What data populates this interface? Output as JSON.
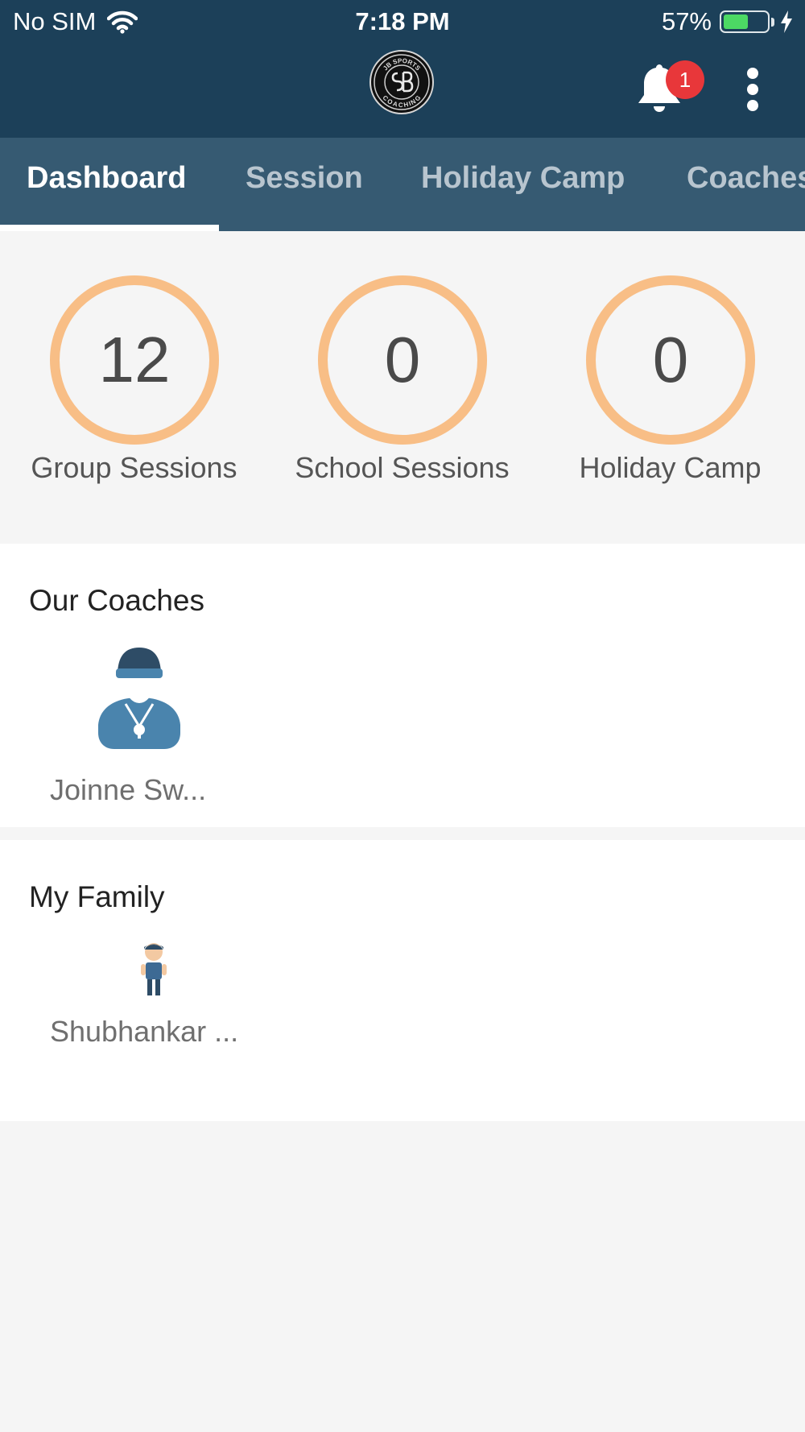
{
  "status_bar": {
    "carrier": "No SIM",
    "time": "7:18 PM",
    "battery_percent_text": "57%",
    "battery_level": 0.57
  },
  "header": {
    "logo_text_top": "JB SPORTS",
    "logo_text_bottom": "COACHING",
    "notification_count": "1",
    "icons": [
      "wifi-icon",
      "battery-icon",
      "charging-icon",
      "bell-icon",
      "more-vertical-icon"
    ]
  },
  "tabs": [
    {
      "label": "Dashboard",
      "active": true
    },
    {
      "label": "Session",
      "active": false
    },
    {
      "label": "Holiday Camp",
      "active": false
    },
    {
      "label": "Coaches",
      "active": false
    }
  ],
  "stats": [
    {
      "value": "12",
      "label": "Group Sessions"
    },
    {
      "value": "0",
      "label": "School Sessions"
    },
    {
      "value": "0",
      "label": "Holiday Camp"
    }
  ],
  "coaches": {
    "title": "Our Coaches",
    "items": [
      {
        "name": "Joinne Sw..."
      }
    ]
  },
  "family": {
    "title": "My Family",
    "items": [
      {
        "name": "Shubhankar ..."
      }
    ]
  },
  "colors": {
    "header_bg": "#1c4059",
    "tab_bar_bg": "#365a72",
    "ring": "#f8be86",
    "badge": "#e8373a",
    "battery_fill": "#4cd964"
  }
}
